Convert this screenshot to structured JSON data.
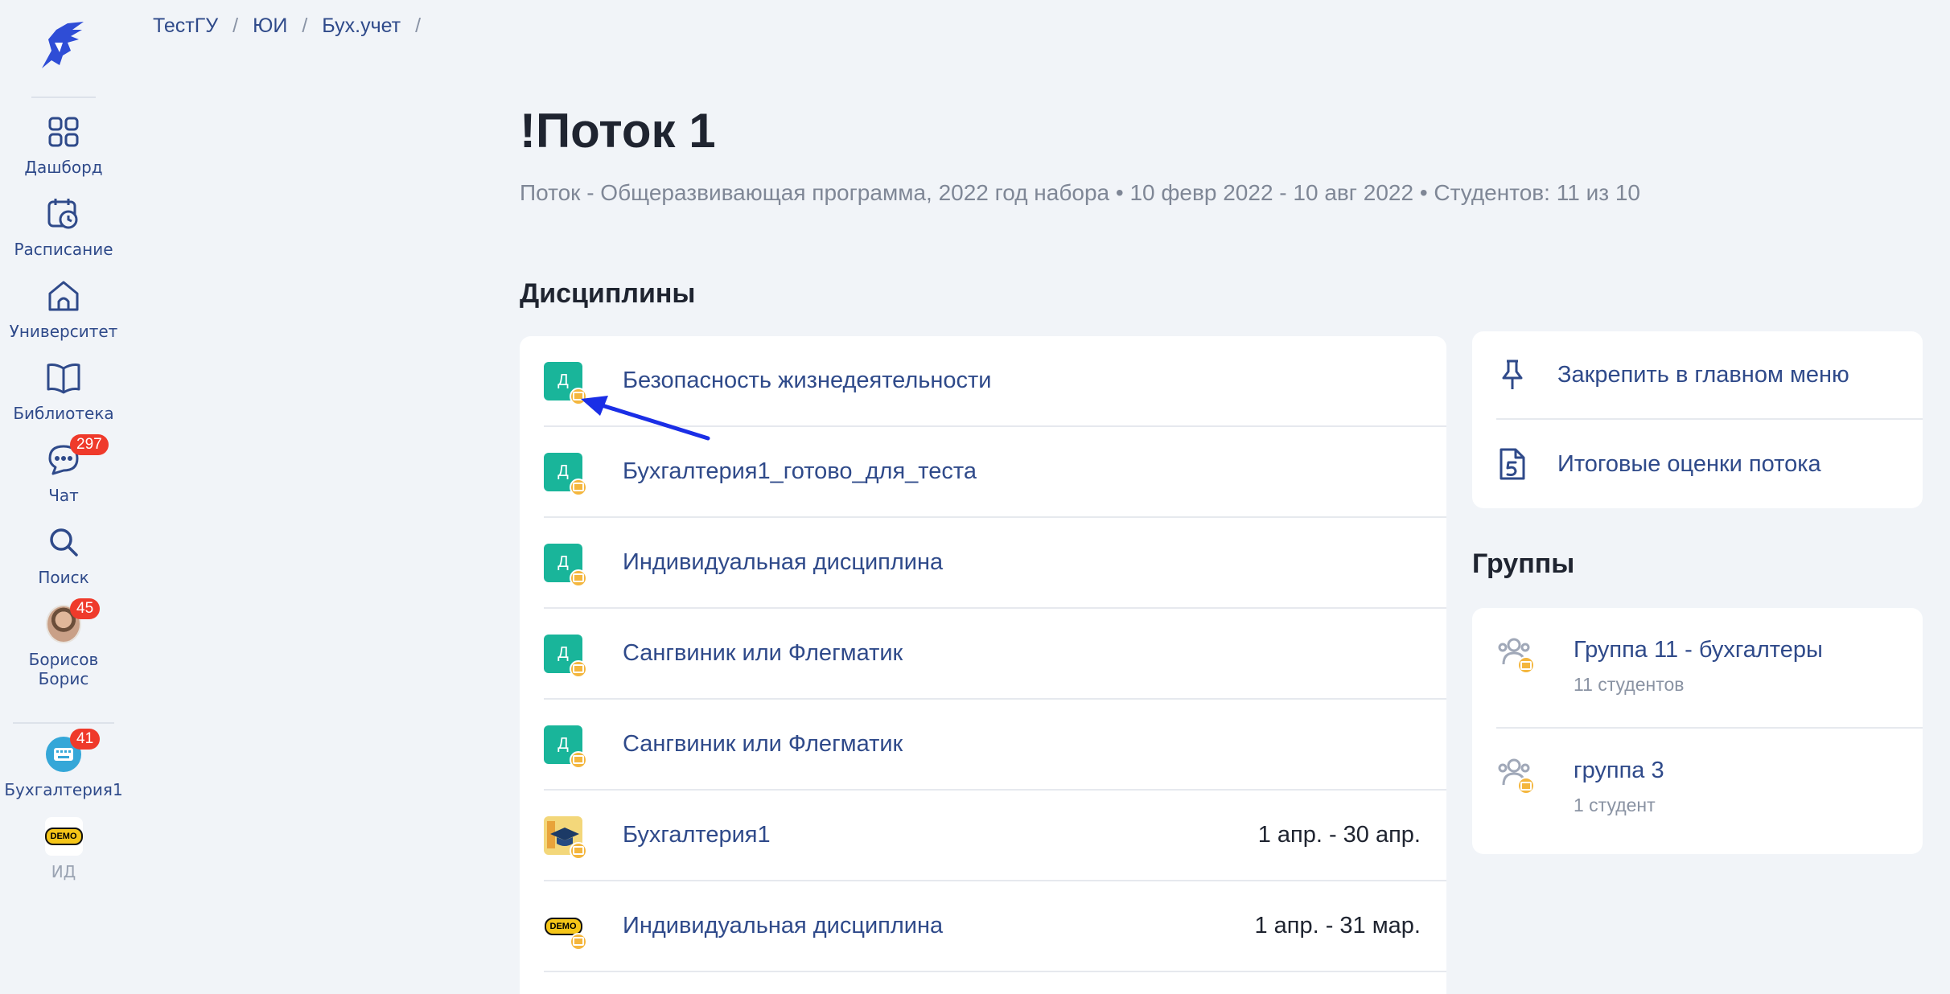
{
  "sidebar": {
    "items": [
      {
        "label": "Дашборд",
        "icon": "dashboard-grid-icon"
      },
      {
        "label": "Расписание",
        "icon": "calendar-clock-icon"
      },
      {
        "label": "Университет",
        "icon": "university-home-icon"
      },
      {
        "label": "Библиотека",
        "icon": "book-icon"
      },
      {
        "label": "Чат",
        "icon": "chat-icon",
        "badge": "297"
      },
      {
        "label": "Поиск",
        "icon": "search-icon"
      },
      {
        "label": "Борисов Борис",
        "icon": "user-avatar",
        "badge": "45"
      },
      {
        "label": "Бухгалтерия1",
        "icon": "course-avatar",
        "badge": "41"
      },
      {
        "label": "ИД",
        "icon": "demo-avatar",
        "demo_text": "DEMO"
      }
    ]
  },
  "breadcrumb": [
    "ТестГУ",
    "ЮИ",
    "Бух.учет"
  ],
  "page": {
    "title": "!Поток 1",
    "subtitle": "Поток - Общеразвивающая программа, 2022 год набора • 10 февр 2022 - 10 авг 2022 • Студентов: 11 из 10"
  },
  "disciplines": {
    "title": "Дисциплины",
    "items": [
      {
        "name": "Безопасность жизнедеятельности",
        "icon_letter": "Д",
        "date": ""
      },
      {
        "name": "Бухгалтерия1_готово_для_теста",
        "icon_letter": "Д",
        "date": ""
      },
      {
        "name": "Индивидуальная дисциплина",
        "icon_letter": "Д",
        "date": ""
      },
      {
        "name": "Сангвиник или Флегматик",
        "icon_letter": "Д",
        "date": ""
      },
      {
        "name": "Сангвиник или Флегматик",
        "icon_letter": "Д",
        "date": ""
      },
      {
        "name": "Бухгалтерия1",
        "icon_letter": "",
        "date": "1 апр. - 30 апр."
      },
      {
        "name": "Индивидуальная дисциплина",
        "icon_letter": "",
        "date": "1 апр. - 31 мар."
      }
    ]
  },
  "actions": {
    "pin_label": "Закрепить в главном меню",
    "grades_label": "Итоговые оценки потока"
  },
  "groups": {
    "title": "Группы",
    "items": [
      {
        "name": "Группа 11 - бухгалтеры",
        "count": "11 студентов"
      },
      {
        "name": "группа 3",
        "count": "1 студент"
      }
    ]
  },
  "colors": {
    "accent": "#2f4a8a",
    "teal": "#19b59a",
    "badge": "#ef3a2b",
    "arrow": "#1a2ee6"
  }
}
